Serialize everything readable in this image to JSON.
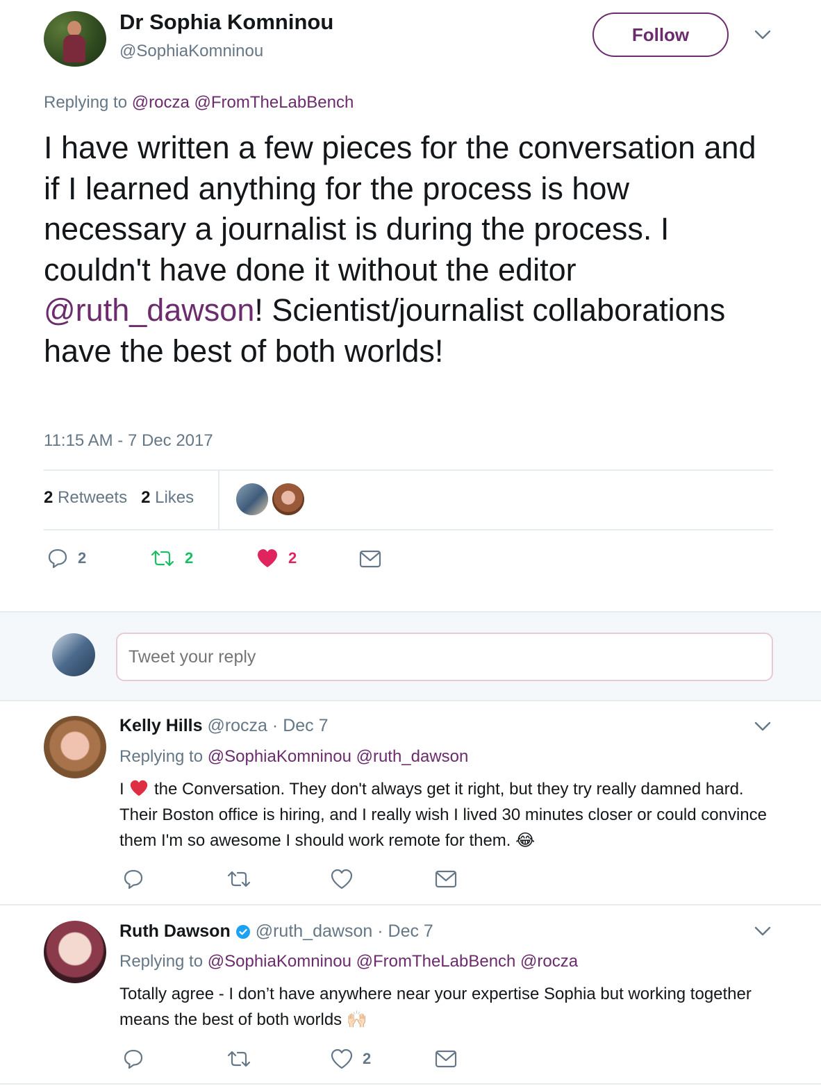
{
  "main_tweet": {
    "author_name": "Dr Sophia Komninou",
    "author_handle": "@SophiaKomninou",
    "follow_label": "Follow",
    "replying_prefix": "Replying to",
    "replying_to": [
      "@rocza",
      "@FromTheLabBench"
    ],
    "text_part1": "I have written a few pieces for the conversation and if I learned anything for the process is how necessary a journalist is during the process. I couldn't have done it without the editor ",
    "text_mention": "@ruth_dawson",
    "text_part2": "! Scientist/journalist collaborations have the best of both worlds!",
    "timestamp": "11:15 AM - 7 Dec 2017",
    "stats": {
      "retweets_count": "2",
      "retweets_label": "Retweets",
      "likes_count": "2",
      "likes_label": "Likes"
    },
    "actions": {
      "reply_count": "2",
      "retweet_count": "2",
      "like_count": "2"
    }
  },
  "reply_box": {
    "placeholder": "Tweet your reply"
  },
  "replies": [
    {
      "name": "Kelly Hills",
      "handle": "@rocza",
      "date": "· Dec 7",
      "replying_prefix": "Replying to",
      "replying_to": "@SophiaKomninou @ruth_dawson",
      "text_start": "I",
      "text_rest": " the Conversation. They don't always get it right, but they try really damned hard. Their Boston office is hiring, and I really wish I lived 30 minutes closer or could convince them I'm so awesome I should work remote for them.",
      "emoji": "😂",
      "like_count": ""
    },
    {
      "name": "Ruth Dawson",
      "handle": "@ruth_dawson",
      "date": "· Dec 7",
      "replying_prefix": "Replying to",
      "replying_to": "@SophiaKomninou @FromTheLabBench @rocza",
      "text": "Totally agree - I don’t have anywhere near your expertise Sophia but working together means the best of both worlds",
      "emoji": "🙌🏻",
      "like_count": "2"
    }
  ],
  "colors": {
    "accent": "#6b2b6d",
    "heart_active": "#e0245e",
    "retweet_active": "#17bf63",
    "verified": "#1da1f2",
    "muted": "#657786"
  },
  "icons": [
    "chevron-down-icon",
    "reply-icon",
    "retweet-icon",
    "heart-icon",
    "dm-icon",
    "verified-icon"
  ]
}
